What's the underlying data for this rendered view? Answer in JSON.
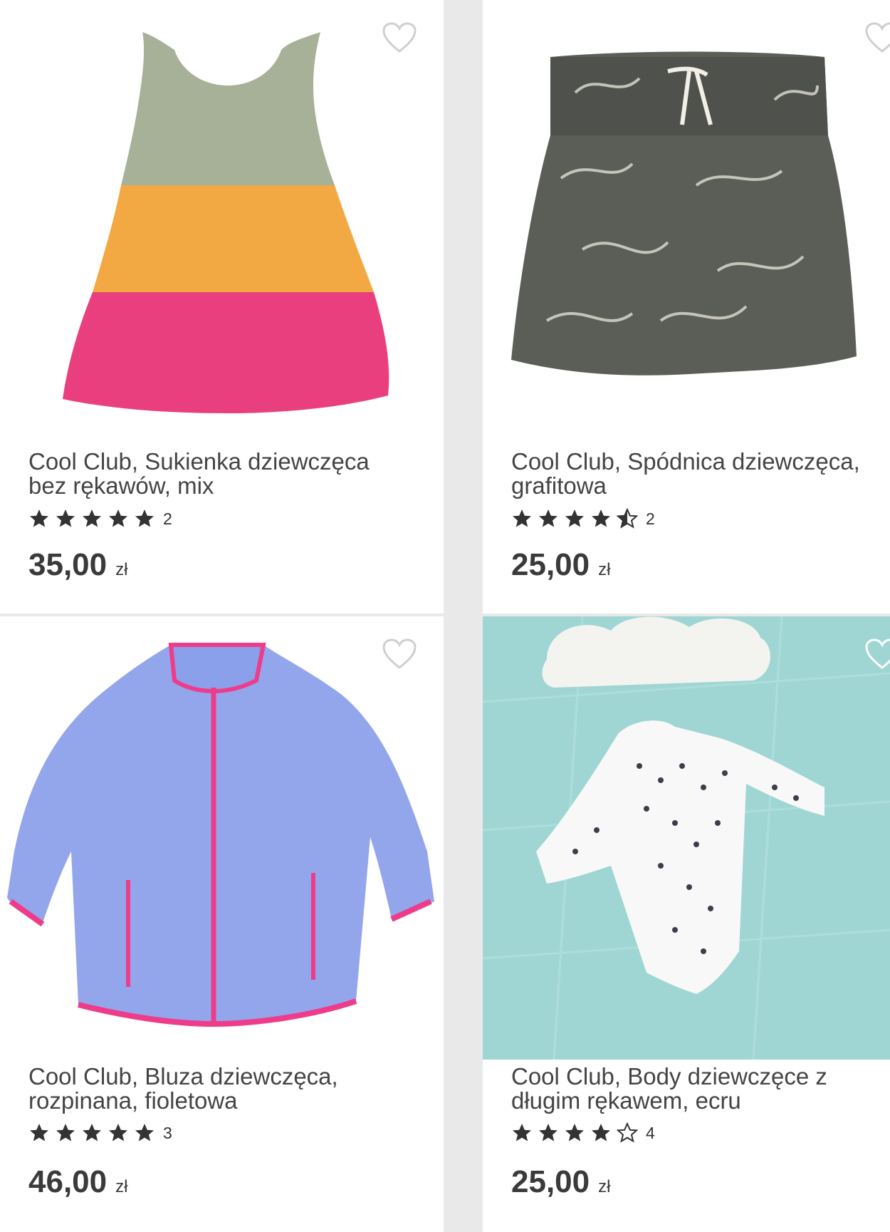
{
  "products": [
    {
      "title": "Cool Club, Sukienka dziewczęca bez rękawów, mix",
      "rating_value": 5,
      "rating_count": "2",
      "price": "35,00",
      "currency": "zł",
      "image_icon": "tiered-dress-image"
    },
    {
      "title": "Cool Club, Spódnica dziewczęca, grafitowa",
      "rating_value": 4.5,
      "rating_count": "2",
      "price": "25,00",
      "currency": "zł",
      "image_icon": "floral-skirt-image"
    },
    {
      "title": "Cool Club, Bluza dziewczęca, rozpinana, fioletowa",
      "rating_value": 5,
      "rating_count": "3",
      "price": "46,00",
      "currency": "zł",
      "image_icon": "fleece-jacket-image"
    },
    {
      "title": "Cool Club, Body dziewczęce z długim rękawem, ecru",
      "rating_value": 4,
      "rating_count": "4",
      "price": "25,00",
      "currency": "zł",
      "image_icon": "baby-bodysuit-image"
    }
  ],
  "colors": {
    "star": "#333333",
    "heart": "#cfcfcf",
    "price": "#3a3a3a"
  }
}
